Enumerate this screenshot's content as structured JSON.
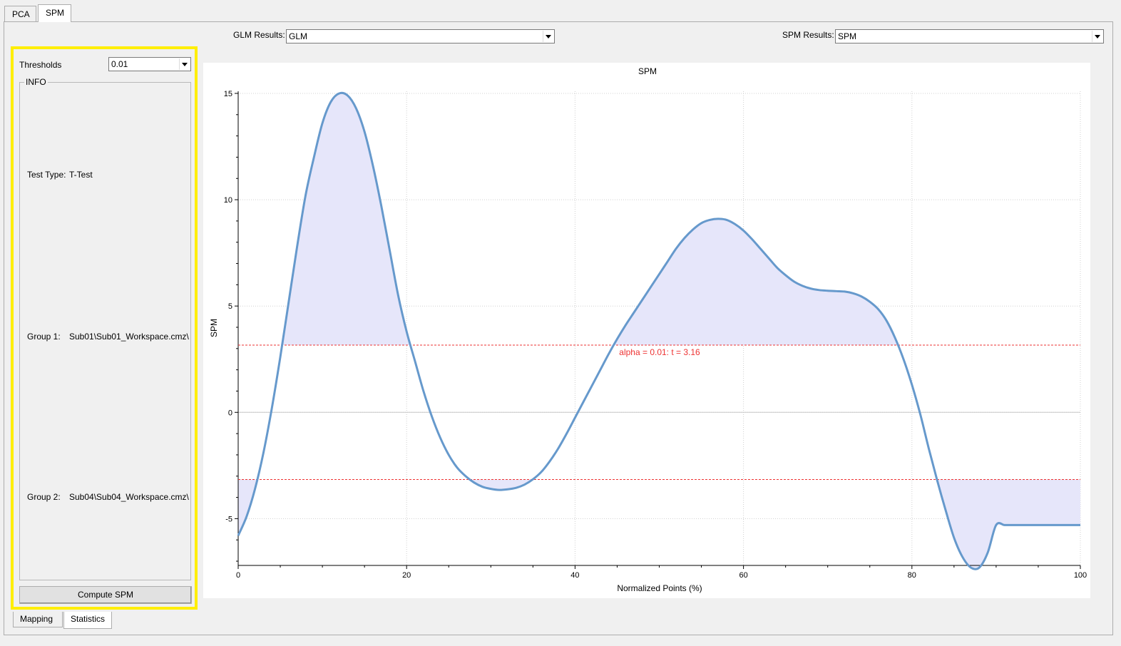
{
  "top_tabs": [
    {
      "label": "PCA",
      "active": false
    },
    {
      "label": "SPM",
      "active": true
    }
  ],
  "toolbar": {
    "glm_label": "GLM Results:",
    "glm_value": "GLM",
    "spm_label": "SPM Results:",
    "spm_value": "SPM"
  },
  "panel": {
    "thresholds_label": "Thresholds",
    "thresholds_value": "0.01",
    "info_title": "INFO",
    "test_type_label": "Test Type:",
    "test_type_value": "T-Test",
    "group1_label": "Group 1:",
    "group1_value": "Sub01\\Sub01_Workspace.cmz\\",
    "group2_label": "Group 2:",
    "group2_value": "Sub04\\Sub04_Workspace.cmz\\",
    "compute_button": "Compute SPM",
    "highlight_color": "#ffee00"
  },
  "bottom_tabs": [
    {
      "label": "Mapping",
      "active": false
    },
    {
      "label": "Statistics",
      "active": true
    }
  ],
  "chart_data": {
    "type": "line",
    "title": "SPM",
    "xlabel": "Normalized Points (%)",
    "ylabel": "SPM",
    "xlim": [
      0,
      100
    ],
    "ylim": [
      -7.2,
      15.1
    ],
    "x_ticks": [
      0,
      20,
      40,
      60,
      80,
      100
    ],
    "y_ticks": [
      -5,
      0,
      5,
      10,
      15
    ],
    "grid": true,
    "threshold": 3.16,
    "threshold_label": "alpha = 0.01: t = 3.16",
    "line_color": "#6699cc",
    "fill_color": "#e6e6fa",
    "threshold_color": "#ee3333",
    "x": [
      0,
      1,
      2,
      3,
      4,
      5,
      6,
      7,
      8,
      9,
      10,
      11,
      12,
      13,
      14,
      15,
      16,
      17,
      18,
      19,
      20,
      21,
      22,
      23,
      24,
      25,
      26,
      27,
      28,
      29,
      30,
      31,
      32,
      33,
      34,
      35,
      36,
      37,
      38,
      39,
      40,
      41,
      42,
      43,
      44,
      45,
      46,
      47,
      48,
      49,
      50,
      51,
      52,
      53,
      54,
      55,
      56,
      57,
      58,
      59,
      60,
      61,
      62,
      63,
      64,
      65,
      66,
      67,
      68,
      69,
      70,
      71,
      72,
      73,
      74,
      75,
      76,
      77,
      78,
      79,
      80,
      81,
      82,
      83,
      84,
      85,
      86,
      87,
      88,
      89,
      90,
      91,
      92,
      93,
      94,
      95,
      96,
      97,
      98,
      99,
      100
    ],
    "values": [
      -5.8,
      -4.9,
      -3.6,
      -1.9,
      0.2,
      2.6,
      5.2,
      7.8,
      10.2,
      12.0,
      13.6,
      14.6,
      15.0,
      14.9,
      14.3,
      13.2,
      11.6,
      9.7,
      7.6,
      5.5,
      3.8,
      2.4,
      1.0,
      -0.2,
      -1.2,
      -2.0,
      -2.6,
      -3.0,
      -3.3,
      -3.5,
      -3.6,
      -3.65,
      -3.62,
      -3.55,
      -3.4,
      -3.15,
      -2.8,
      -2.3,
      -1.7,
      -1.0,
      -0.25,
      0.5,
      1.25,
      2.0,
      2.75,
      3.45,
      4.1,
      4.7,
      5.3,
      5.9,
      6.5,
      7.1,
      7.7,
      8.2,
      8.6,
      8.9,
      9.05,
      9.1,
      9.05,
      8.85,
      8.55,
      8.15,
      7.7,
      7.25,
      6.8,
      6.45,
      6.15,
      5.95,
      5.82,
      5.75,
      5.72,
      5.7,
      5.68,
      5.6,
      5.45,
      5.2,
      4.85,
      4.3,
      3.5,
      2.5,
      1.3,
      -0.1,
      -1.7,
      -3.2,
      -4.6,
      -5.9,
      -6.8,
      -7.3,
      -7.3,
      -6.6,
      -5.3,
      -5.3,
      -5.3,
      -5.3,
      -5.3,
      -5.3,
      -5.3,
      -5.3,
      -5.3,
      -5.3,
      -5.3
    ]
  }
}
